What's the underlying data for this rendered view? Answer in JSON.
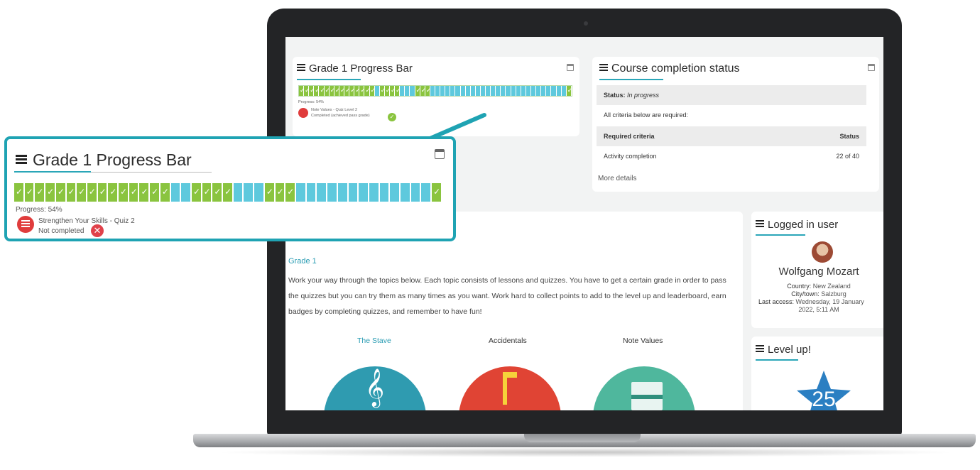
{
  "progress_block": {
    "title": "Grade 1 Progress Bar",
    "progress_text": "Progress: 54%",
    "mini_activity_name": "Note Values - Quiz Level 2",
    "mini_activity_status": "Completed (achieved pass grade)",
    "activity_name": "Strengthen Your Skills - Quiz 2",
    "activity_status": "Not completed",
    "mini_segments": [
      1,
      1,
      1,
      1,
      1,
      1,
      1,
      1,
      1,
      1,
      1,
      1,
      1,
      1,
      1,
      0,
      1,
      1,
      1,
      1,
      0,
      0,
      0,
      1,
      1,
      1,
      0,
      0,
      0,
      0,
      0,
      0,
      0,
      0,
      0,
      0,
      0,
      0,
      0,
      0,
      0,
      0,
      0,
      0,
      0,
      0,
      0,
      0,
      0,
      0,
      0,
      0,
      0,
      1
    ],
    "segments": [
      1,
      1,
      1,
      1,
      1,
      1,
      1,
      1,
      1,
      1,
      1,
      1,
      1,
      1,
      1,
      0,
      0,
      1,
      1,
      1,
      1,
      0,
      0,
      0,
      1,
      1,
      1,
      0,
      0,
      0,
      0,
      0,
      0,
      0,
      0,
      0,
      0,
      0,
      0,
      0,
      1
    ]
  },
  "completion_block": {
    "title": "Course completion status",
    "status_label": "Status:",
    "status_value": "In progress",
    "criteria_note": "All criteria below are required:",
    "header_criteria": "Required criteria",
    "header_status": "Status",
    "activity_label": "Activity completion",
    "activity_value": "22 of 40",
    "more_link": "More details"
  },
  "course": {
    "grade_link": "Grade 1",
    "intro": "Work your way through the topics below. Each topic consists of lessons and quizzes. You have to get a certain grade in order to pass the quizzes but you can try them as many times as you want. Work hard to collect points to add to the level up and leaderboard, earn badges by completing quizzes, and remember to have fun!",
    "topics": [
      {
        "label": "The Stave",
        "color": "#2f9bb0",
        "label_color": "#2a9cb3"
      },
      {
        "label": "Accidentals",
        "color": "#e04434",
        "label_color": "#333333"
      },
      {
        "label": "Note Values",
        "color": "#4fb79d",
        "label_color": "#333333"
      }
    ]
  },
  "user_block": {
    "title": "Logged in user",
    "name": "Wolfgang Mozart",
    "country_label": "Country:",
    "country_value": "New Zealand",
    "city_label": "City/town:",
    "city_value": "Salzburg",
    "access_label": "Last access:",
    "access_value": "Wednesday, 19 January",
    "access_value2": "2022, 5:11 AM"
  },
  "level_block": {
    "title": "Level up!",
    "level": "25"
  },
  "icons": [
    "hamburger-icon",
    "calendar-icon",
    "quiz-icon",
    "check-icon",
    "cross-icon",
    "treble-clef-icon",
    "note-icon",
    "sheet-icon",
    "star-icon",
    "avatar"
  ],
  "colors": {
    "accent": "#1fa3b3",
    "done": "#8ac43f",
    "todo": "#5ec9dd",
    "quiz_red": "#e03c3c"
  }
}
